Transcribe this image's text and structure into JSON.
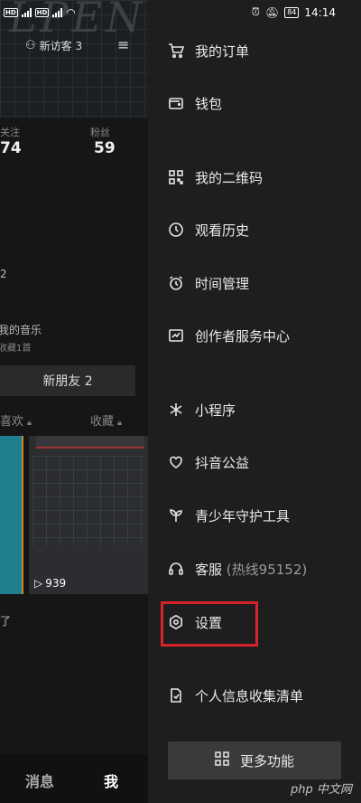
{
  "status_bar": {
    "left_badges": [
      "HD",
      "HD"
    ],
    "time": "14:14",
    "battery": "84"
  },
  "profile": {
    "visitors": "新访客 3",
    "following_label": "关注",
    "following_count": "74",
    "fans_label": "粉丝",
    "fans_count": "59",
    "fragment_2": "2",
    "music_title": "我的音乐",
    "music_sub": "收藏1首",
    "new_friends": "新朋友 2",
    "tab_likes": "喜欢",
    "tab_favorites": "收藏",
    "video_plays": "939",
    "fragment_le": "了"
  },
  "bottom_nav": {
    "messages": "消息",
    "me": "我"
  },
  "drawer": {
    "items": [
      {
        "label": "我的订单",
        "icon": "cart-icon"
      },
      {
        "label": "钱包",
        "icon": "wallet-icon"
      },
      {
        "label": "我的二维码",
        "icon": "qr-code-icon"
      },
      {
        "label": "观看历史",
        "icon": "clock-icon"
      },
      {
        "label": "时间管理",
        "icon": "alarm-icon"
      },
      {
        "label": "创作者服务中心",
        "icon": "chart-icon"
      },
      {
        "label": "小程序",
        "icon": "asterisk-icon"
      },
      {
        "label": "抖音公益",
        "icon": "heart-icon"
      },
      {
        "label": "青少年守护工具",
        "icon": "sprout-icon"
      },
      {
        "label": "客服",
        "hotline": "(热线95152)",
        "icon": "headset-icon"
      },
      {
        "label": "设置",
        "icon": "hexagon-gear-icon"
      },
      {
        "label": "个人信息收集清单",
        "icon": "doc-icon"
      }
    ],
    "more_label": "更多功能",
    "highlight_color": "#d6232a"
  },
  "watermark": "php 中文网"
}
